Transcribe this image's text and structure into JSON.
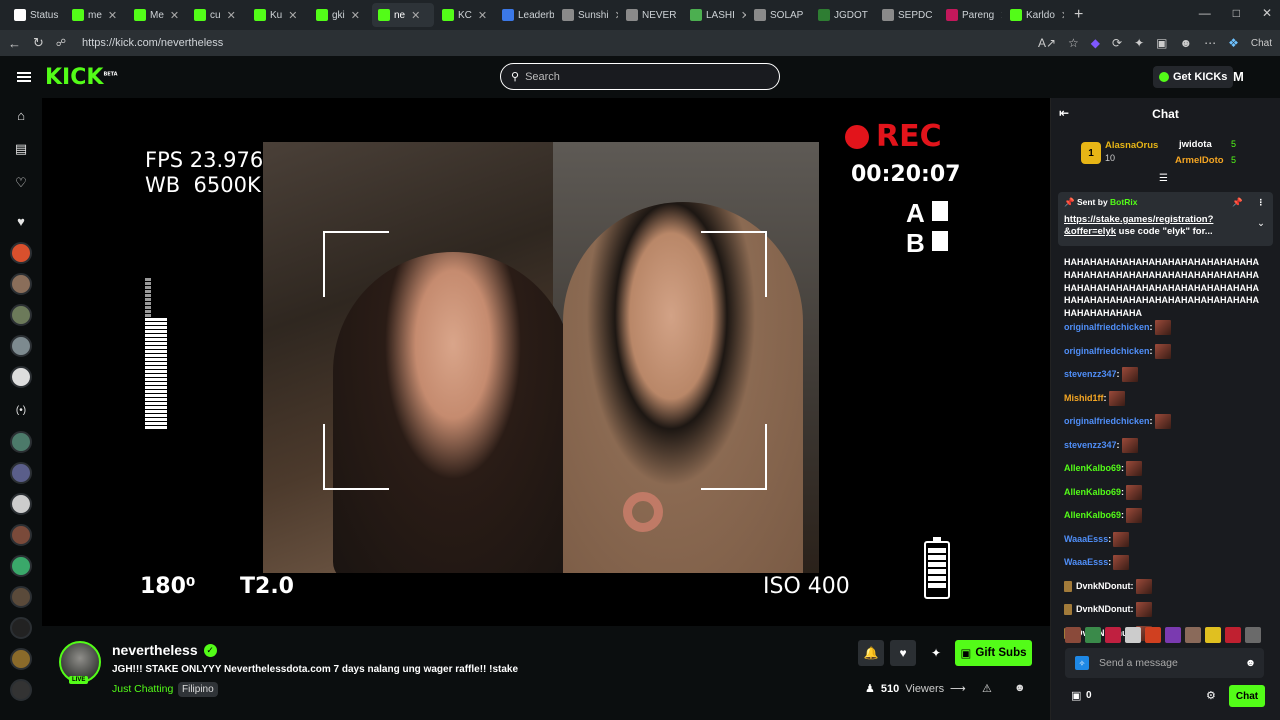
{
  "browser": {
    "tabs": [
      {
        "label": "Status",
        "color": "#ffffff",
        "active": false
      },
      {
        "label": "me",
        "color": "#53fc18",
        "active": false
      },
      {
        "label": "Me",
        "color": "#53fc18",
        "active": false
      },
      {
        "label": "cu",
        "color": "#53fc18",
        "active": false
      },
      {
        "label": "Ku",
        "color": "#53fc18",
        "active": false
      },
      {
        "label": "gki",
        "color": "#53fc18",
        "active": false
      },
      {
        "label": "ne",
        "color": "#53fc18",
        "active": true
      },
      {
        "label": "KC",
        "color": "#53fc18",
        "active": false
      },
      {
        "label": "Leaderboard",
        "color": "#3b78e7",
        "active": false
      },
      {
        "label": "Sunshi",
        "color": "#8a8a8a",
        "active": false
      },
      {
        "label": "NEVER",
        "color": "#8a8a8a",
        "active": false
      },
      {
        "label": "LASHI",
        "color": "#4caf50",
        "active": false
      },
      {
        "label": "SOLAP",
        "color": "#8a8a8a",
        "active": false
      },
      {
        "label": "JGDOT",
        "color": "#2e7d32",
        "active": false
      },
      {
        "label": "SEPDC",
        "color": "#8a8a8a",
        "active": false
      },
      {
        "label": "Pareng",
        "color": "#c2185b",
        "active": false
      },
      {
        "label": "Karldo",
        "color": "#53fc18",
        "active": false
      }
    ],
    "url": "https://kick.com/nevertheless"
  },
  "header": {
    "logo": "KICK",
    "logo_badge": "BETA",
    "search_placeholder": "Search",
    "get_kicks": "Get KICKs",
    "user_initial": "M"
  },
  "video_overlay": {
    "fps": "FPS 23.976",
    "wb": "WB  6500K",
    "rec": "REC",
    "timer": "00:20:07",
    "angle": "180⁰",
    "aperture": "T2.0",
    "iso": "ISO 400",
    "a_label": "A",
    "b_label": "B"
  },
  "channel": {
    "name": "nevertheless",
    "live": "LIVE",
    "title": "JGH!!! STAKE ONLYYY Neverthelessdota.com 7 days nalang ung wager raffle!! !stake",
    "category": "Just Chatting",
    "tag": "Filipino",
    "gift_subs": "Gift Subs",
    "viewers_count": "510",
    "viewers_label": "Viewers"
  },
  "chat": {
    "title": "Chat",
    "leaderboard": {
      "rank": "1",
      "first_name": "AlasnaOrus",
      "first_count": "10",
      "second_name": "jwidota",
      "second_count": "5",
      "third_name": "ArmelDoto",
      "third_count": "5"
    },
    "pinned": {
      "sent_by": "Sent by",
      "bot": "BotRix",
      "link": "https://stake.games/registration?&offer=elyk",
      "rest": " use code \"elyk\" for..."
    },
    "long_message": "HAHAHAHAHAHAHAHAHAHAHAHAHAHAHAHAHAHAHAHAHAHAHAHAHAHAHAHAHAHAHAHAHAHAHAHAHAHAHAHAHAHAHAHAHAHAHAHAHAHAHAHAHAHAHAHAHAHAHAHAHAHAHAHAHAHA",
    "messages": [
      {
        "user": "originalfriedchicken",
        "color": "#4f8ef7"
      },
      {
        "user": "originalfriedchicken",
        "color": "#4f8ef7"
      },
      {
        "user": "stevenzz347",
        "color": "#4f8ef7"
      },
      {
        "user": "Mishid1ff",
        "color": "#f5a623"
      },
      {
        "user": "originalfriedchicken",
        "color": "#4f8ef7"
      },
      {
        "user": "stevenzz347",
        "color": "#4f8ef7"
      },
      {
        "user": "AllenKalbo69",
        "color": "#53fc18"
      },
      {
        "user": "AllenKalbo69",
        "color": "#53fc18"
      },
      {
        "user": "AllenKalbo69",
        "color": "#53fc18"
      },
      {
        "user": "WaaaEsss",
        "color": "#4f8ef7"
      },
      {
        "user": "WaaaEsss",
        "color": "#4f8ef7"
      },
      {
        "user": "DvnkNDonut",
        "color": "#ffffff"
      },
      {
        "user": "DvnkNDonut",
        "color": "#ffffff"
      },
      {
        "user": "DvnkNDonut",
        "color": "#ffffff"
      }
    ],
    "send_placeholder": "Send a message",
    "points": "0",
    "chat_button": "Chat"
  },
  "colors": {
    "accent": "#53fc18",
    "rec": "#e2141b"
  }
}
